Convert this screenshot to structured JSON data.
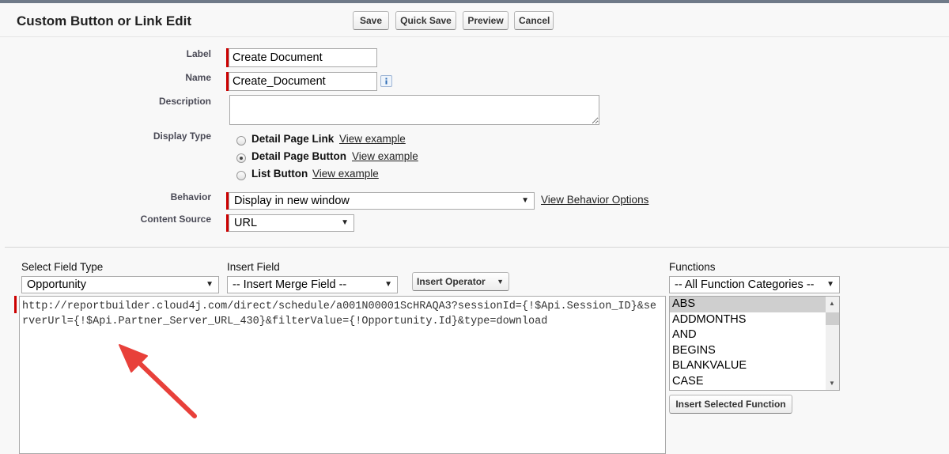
{
  "page": {
    "title": "Custom Button or Link Edit",
    "buttons": {
      "save": "Save",
      "quick_save": "Quick Save",
      "preview": "Preview",
      "cancel": "Cancel"
    }
  },
  "form": {
    "label": {
      "caption": "Label",
      "value": "Create Document"
    },
    "name": {
      "caption": "Name",
      "value": "Create_Document",
      "info_icon": "info-icon"
    },
    "description": {
      "caption": "Description",
      "value": ""
    },
    "display_type": {
      "caption": "Display Type",
      "options": [
        {
          "label": "Detail Page Link",
          "link": "View example",
          "selected": false
        },
        {
          "label": "Detail Page Button",
          "link": "View example",
          "selected": true
        },
        {
          "label": "List Button",
          "link": "View example",
          "selected": false
        }
      ]
    },
    "behavior": {
      "caption": "Behavior",
      "value": "Display in new window",
      "link": "View Behavior Options"
    },
    "content_source": {
      "caption": "Content Source",
      "value": "URL"
    }
  },
  "editor": {
    "select_field_type": {
      "caption": "Select Field Type",
      "value": "Opportunity"
    },
    "insert_field": {
      "caption": "Insert Field",
      "value": "-- Insert Merge Field --"
    },
    "insert_operator": "Insert Operator",
    "formula": "http://reportbuilder.cloud4j.com/direct/schedule/a001N00001ScHRAQA3?sessionId={!$Api.Session_ID}&serverUrl={!$Api.Partner_Server_URL_430}&filterValue={!Opportunity.Id}&type=download",
    "functions": {
      "caption": "Functions",
      "category": "-- All Function Categories --",
      "items": [
        "ABS",
        "ADDMONTHS",
        "AND",
        "BEGINS",
        "BLANKVALUE",
        "CASE"
      ],
      "selected": "ABS",
      "insert_button": "Insert Selected Function"
    }
  },
  "colors": {
    "required": "#cc0000",
    "annotation_arrow": "#e8403a",
    "top_bar": "#6f7a88"
  }
}
